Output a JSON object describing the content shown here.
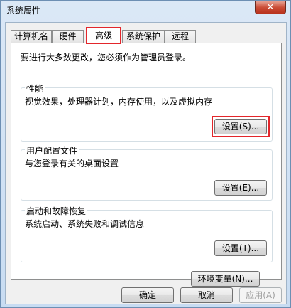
{
  "window": {
    "title": "系统属性",
    "close_glyph": "✕"
  },
  "tabs": [
    {
      "label": "计算机名"
    },
    {
      "label": "硬件"
    },
    {
      "label": "高级"
    },
    {
      "label": "系统保护"
    },
    {
      "label": "远程"
    }
  ],
  "panel": {
    "notice": "要进行大多数更改，您必须作为管理员登录。",
    "groups": [
      {
        "title": "性能",
        "desc": "视觉效果，处理器计划，内存使用，以及虚拟内存",
        "button": "设置(S)..."
      },
      {
        "title": "用户配置文件",
        "desc": "与您登录有关的桌面设置",
        "button": "设置(E)..."
      },
      {
        "title": "启动和故障恢复",
        "desc": "系统启动、系统失败和调试信息",
        "button": "设置(T)..."
      }
    ],
    "env_button": "环境变量(N)..."
  },
  "footer": {
    "ok": "确定",
    "cancel": "取消",
    "apply": "应用(A)"
  },
  "highlight_color": "#e3262b"
}
